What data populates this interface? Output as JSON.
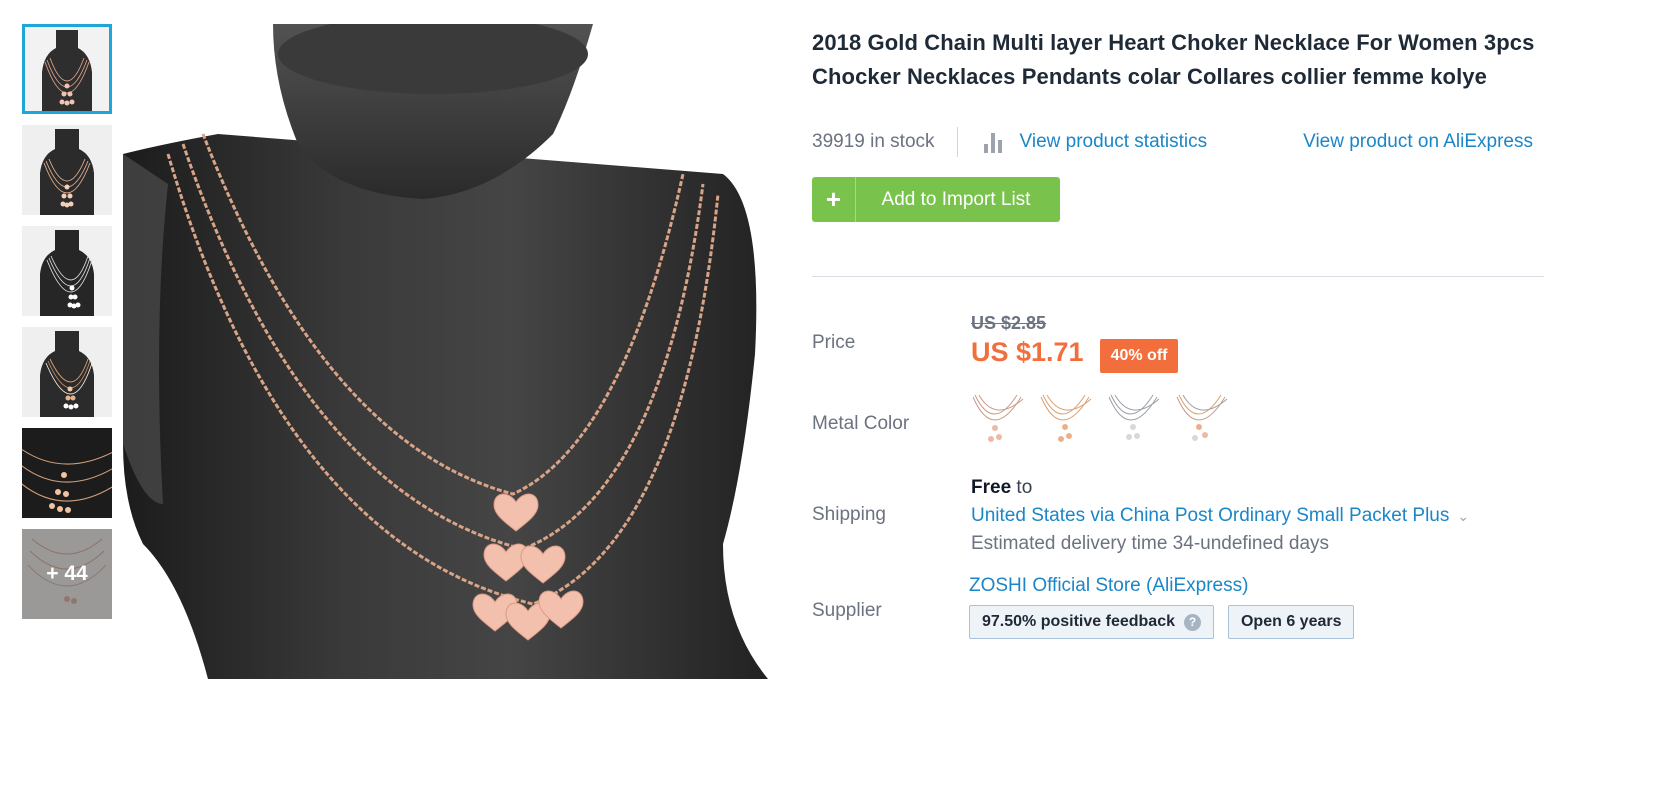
{
  "thumbnails": {
    "items": [
      {
        "label": "thumbnail-1"
      },
      {
        "label": "thumbnail-2"
      },
      {
        "label": "thumbnail-3"
      },
      {
        "label": "thumbnail-4"
      },
      {
        "label": "thumbnail-5"
      },
      {
        "label": "thumbnail-6"
      }
    ],
    "more_label": "+ 44"
  },
  "product": {
    "title": "2018 Gold Chain Multi layer Heart Choker Necklace For Women 3pcs Chocker Necklaces Pendants colar Collares collier femme kolye",
    "stock": "39919 in stock",
    "stats_link": "View product statistics",
    "ali_link": "View product on AliExpress",
    "add_button": "Add to Import List",
    "add_icon": "+"
  },
  "price": {
    "label": "Price",
    "old": "US $2.85",
    "new": "US $1.71",
    "discount": "40% off"
  },
  "metal_color": {
    "label": "Metal Color",
    "options": [
      "rose-gold",
      "gold",
      "silver",
      "mixed"
    ]
  },
  "shipping": {
    "label": "Shipping",
    "free": "Free",
    "to": "to",
    "method": "United States via China Post Ordinary Small Packet Plus",
    "estimate": "Estimated delivery time 34-undefined days"
  },
  "supplier": {
    "label": "Supplier",
    "name": "ZOSHI Official Store (AliExpress)",
    "feedback": "97.50% positive feedback",
    "help_icon": "?",
    "years": "Open 6 years"
  },
  "colors": {
    "accent_blue": "#1b86c7",
    "button_green": "#79c34d",
    "price_orange": "#f26e3c",
    "thumb_active": "#1fa6d8"
  }
}
